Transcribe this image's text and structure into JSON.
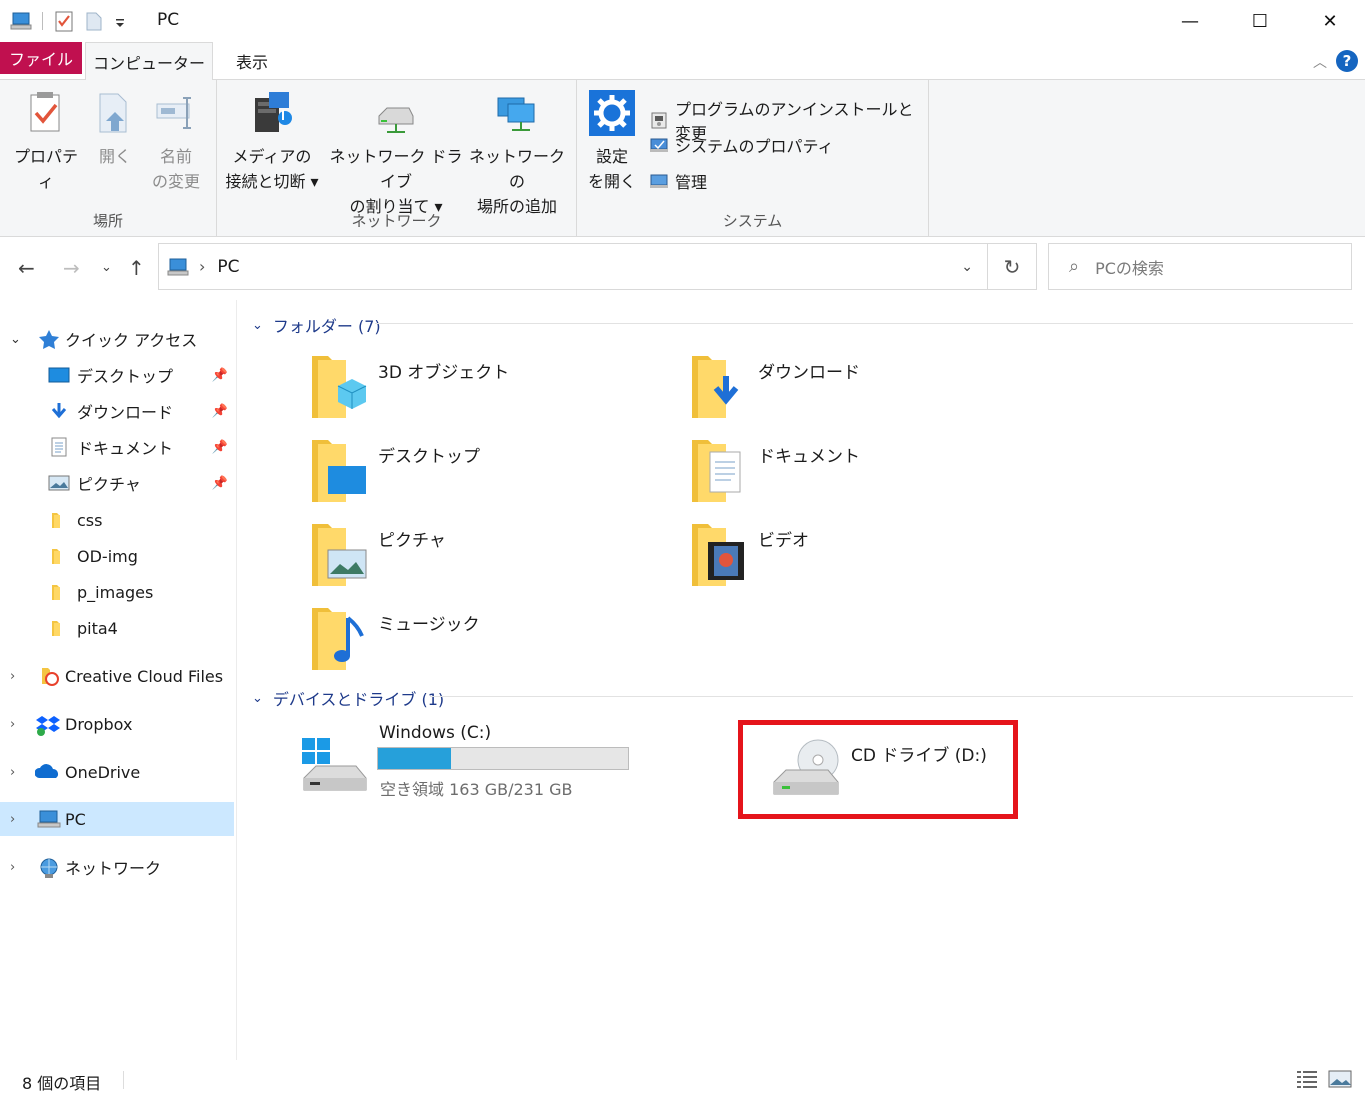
{
  "window": {
    "title": "PC",
    "minimize": "—",
    "maximize": "☐",
    "close": "✕"
  },
  "ribbon_tabs": [
    {
      "label": "ファイル"
    },
    {
      "label": "コンピューター"
    },
    {
      "label": "表示"
    }
  ],
  "ribbon": {
    "groups": [
      {
        "label": "場所",
        "buttons": [
          {
            "line1": "プロパティ",
            "line2": ""
          },
          {
            "line1": "開く",
            "line2": ""
          },
          {
            "line1": "名前",
            "line2": "の変更"
          }
        ]
      },
      {
        "label": "ネットワーク",
        "buttons": [
          {
            "line1": "メディアの",
            "line2": "接続と切断 ▾"
          },
          {
            "line1": "ネットワーク ドライブ",
            "line2": "の割り当て ▾"
          },
          {
            "line1": "ネットワークの",
            "line2": "場所の追加"
          }
        ]
      },
      {
        "label": "システム",
        "buttons": [
          {
            "line1": "設定",
            "line2": "を開く"
          }
        ],
        "small_buttons": [
          {
            "label": "プログラムのアンインストールと変更"
          },
          {
            "label": "システムのプロパティ"
          },
          {
            "label": "管理"
          }
        ]
      }
    ]
  },
  "address": {
    "path": "PC",
    "separator": "›",
    "search_placeholder": "PCの検索"
  },
  "nav": {
    "quick_access": "クイック アクセス",
    "items": [
      {
        "label": "デスクトップ",
        "pinned": true
      },
      {
        "label": "ダウンロード",
        "pinned": true
      },
      {
        "label": "ドキュメント",
        "pinned": true
      },
      {
        "label": "ピクチャ",
        "pinned": true
      },
      {
        "label": "css",
        "pinned": false
      },
      {
        "label": "OD-img",
        "pinned": false
      },
      {
        "label": "p_images",
        "pinned": false
      },
      {
        "label": "pita4",
        "pinned": false
      }
    ],
    "roots": [
      {
        "label": "Creative Cloud Files"
      },
      {
        "label": "Dropbox"
      },
      {
        "label": "OneDrive"
      },
      {
        "label": "PC"
      },
      {
        "label": "ネットワーク"
      }
    ]
  },
  "folders_section": {
    "title": "フォルダー (7)",
    "folders": [
      {
        "label": "3D オブジェクト"
      },
      {
        "label": "ダウンロード"
      },
      {
        "label": "デスクトップ"
      },
      {
        "label": "ドキュメント"
      },
      {
        "label": "ピクチャ"
      },
      {
        "label": "ビデオ"
      },
      {
        "label": "ミュージック"
      }
    ]
  },
  "devices_section": {
    "title": "デバイスとドライブ (1)",
    "drives": [
      {
        "label": "Windows (C:)",
        "free_text": "空き領域 163 GB/231 GB",
        "used_fraction": 0.29
      },
      {
        "label": "CD ドライブ (D:)"
      }
    ]
  },
  "status": {
    "items_count": "8 個の項目"
  },
  "colors": {
    "file_tab": "#c0104f",
    "selection": "#cce8ff",
    "drive_bar": "#26a0da",
    "highlight_box": "#e5141b",
    "section_header": "#1e3a8a"
  }
}
